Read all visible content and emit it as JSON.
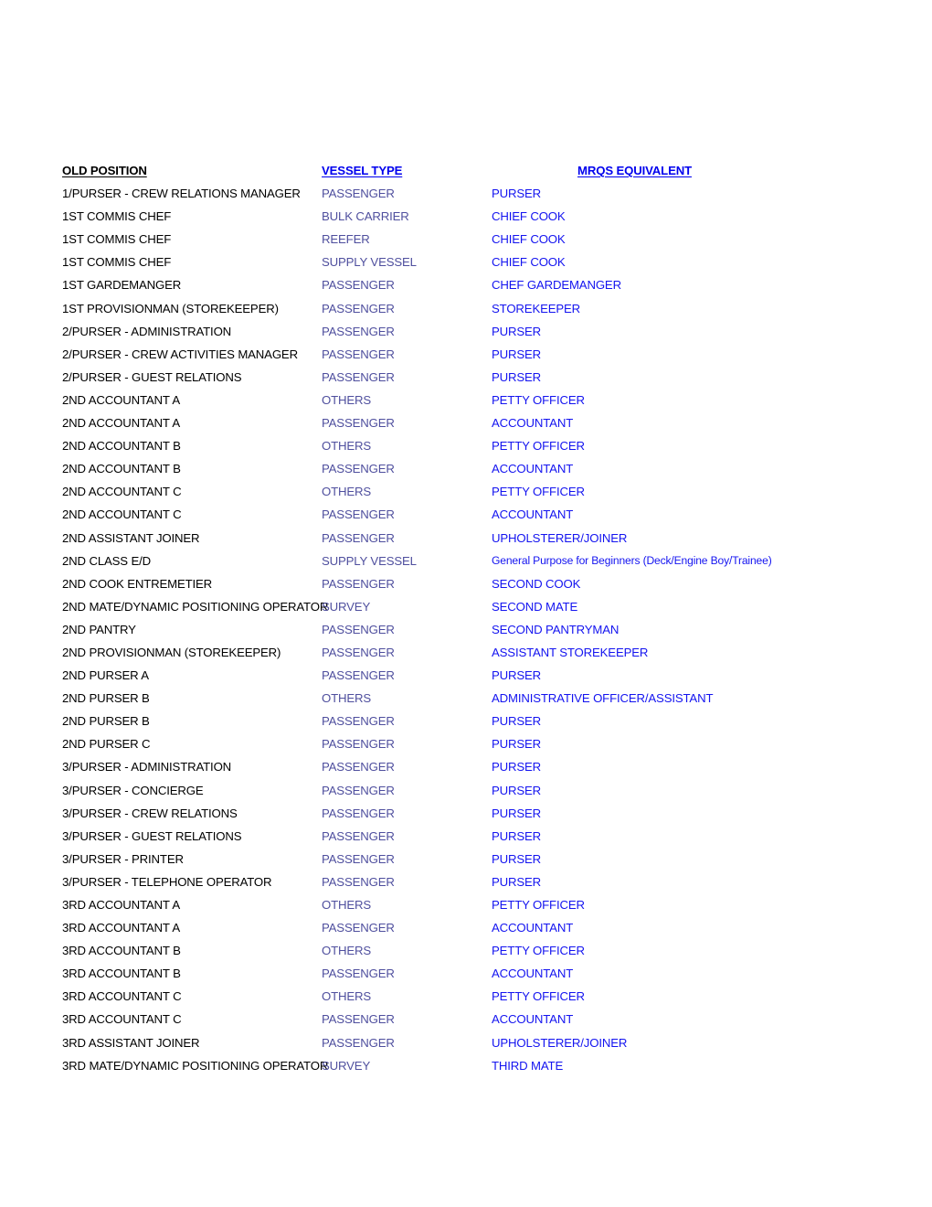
{
  "document": {
    "headers": {
      "col1": "OLD POSITION",
      "col2": "VESSEL TYPE",
      "col3": "MRQS EQUIVALENT"
    },
    "colors": {
      "col1_text": "#000000",
      "col2_text": "#4f4f9e",
      "col3_text": "#1414f0",
      "header_col1": "#000000",
      "header_accent": "#0000ee",
      "background": "#ffffff"
    },
    "rows": [
      {
        "old_position": "1/PURSER - CREW RELATIONS MANAGER",
        "vessel_type": "PASSENGER",
        "mrqs_equivalent": "PURSER"
      },
      {
        "old_position": "1ST COMMIS CHEF",
        "vessel_type": "BULK CARRIER",
        "mrqs_equivalent": "CHIEF COOK"
      },
      {
        "old_position": "1ST COMMIS CHEF",
        "vessel_type": "REEFER",
        "mrqs_equivalent": "CHIEF COOK"
      },
      {
        "old_position": "1ST COMMIS CHEF",
        "vessel_type": "SUPPLY VESSEL",
        "mrqs_equivalent": "CHIEF COOK"
      },
      {
        "old_position": "1ST GARDEMANGER",
        "vessel_type": "PASSENGER",
        "mrqs_equivalent": "CHEF GARDEMANGER"
      },
      {
        "old_position": "1ST PROVISIONMAN (STOREKEEPER)",
        "vessel_type": "PASSENGER",
        "mrqs_equivalent": "STOREKEEPER"
      },
      {
        "old_position": "2/PURSER - ADMINISTRATION",
        "vessel_type": "PASSENGER",
        "mrqs_equivalent": "PURSER"
      },
      {
        "old_position": "2/PURSER - CREW ACTIVITIES MANAGER",
        "vessel_type": "PASSENGER",
        "mrqs_equivalent": "PURSER"
      },
      {
        "old_position": "2/PURSER - GUEST RELATIONS",
        "vessel_type": "PASSENGER",
        "mrqs_equivalent": "PURSER"
      },
      {
        "old_position": "2ND ACCOUNTANT A",
        "vessel_type": "OTHERS",
        "mrqs_equivalent": "PETTY OFFICER"
      },
      {
        "old_position": "2ND ACCOUNTANT A",
        "vessel_type": "PASSENGER",
        "mrqs_equivalent": "ACCOUNTANT"
      },
      {
        "old_position": "2ND ACCOUNTANT B",
        "vessel_type": "OTHERS",
        "mrqs_equivalent": "PETTY OFFICER"
      },
      {
        "old_position": "2ND ACCOUNTANT B",
        "vessel_type": "PASSENGER",
        "mrqs_equivalent": "ACCOUNTANT"
      },
      {
        "old_position": "2ND ACCOUNTANT C",
        "vessel_type": "OTHERS",
        "mrqs_equivalent": "PETTY OFFICER"
      },
      {
        "old_position": "2ND ACCOUNTANT C",
        "vessel_type": "PASSENGER",
        "mrqs_equivalent": "ACCOUNTANT"
      },
      {
        "old_position": "2ND ASSISTANT JOINER",
        "vessel_type": "PASSENGER",
        "mrqs_equivalent": "UPHOLSTERER/JOINER"
      },
      {
        "old_position": "2ND CLASS E/D",
        "vessel_type": "SUPPLY VESSEL",
        "mrqs_equivalent": "General Purpose for Beginners (Deck/Engine Boy/Trainee)",
        "small": true
      },
      {
        "old_position": "2ND COOK ENTREMETIER",
        "vessel_type": "PASSENGER",
        "mrqs_equivalent": "SECOND COOK"
      },
      {
        "old_position": "2ND MATE/DYNAMIC POSITIONING OPERATOR",
        "vessel_type": "SURVEY",
        "mrqs_equivalent": "SECOND MATE"
      },
      {
        "old_position": "2ND PANTRY",
        "vessel_type": "PASSENGER",
        "mrqs_equivalent": "SECOND PANTRYMAN"
      },
      {
        "old_position": "2ND PROVISIONMAN (STOREKEEPER)",
        "vessel_type": "PASSENGER",
        "mrqs_equivalent": "ASSISTANT STOREKEEPER"
      },
      {
        "old_position": "2ND PURSER A",
        "vessel_type": "PASSENGER",
        "mrqs_equivalent": "PURSER"
      },
      {
        "old_position": "2ND PURSER B",
        "vessel_type": "OTHERS",
        "mrqs_equivalent": "ADMINISTRATIVE OFFICER/ASSISTANT"
      },
      {
        "old_position": "2ND PURSER B",
        "vessel_type": "PASSENGER",
        "mrqs_equivalent": "PURSER"
      },
      {
        "old_position": "2ND PURSER C",
        "vessel_type": "PASSENGER",
        "mrqs_equivalent": "PURSER"
      },
      {
        "old_position": "3/PURSER - ADMINISTRATION",
        "vessel_type": "PASSENGER",
        "mrqs_equivalent": "PURSER"
      },
      {
        "old_position": "3/PURSER - CONCIERGE",
        "vessel_type": "PASSENGER",
        "mrqs_equivalent": "PURSER"
      },
      {
        "old_position": "3/PURSER - CREW RELATIONS",
        "vessel_type": "PASSENGER",
        "mrqs_equivalent": "PURSER"
      },
      {
        "old_position": "3/PURSER - GUEST RELATIONS",
        "vessel_type": "PASSENGER",
        "mrqs_equivalent": "PURSER"
      },
      {
        "old_position": "3/PURSER - PRINTER",
        "vessel_type": "PASSENGER",
        "mrqs_equivalent": "PURSER"
      },
      {
        "old_position": "3/PURSER - TELEPHONE OPERATOR",
        "vessel_type": "PASSENGER",
        "mrqs_equivalent": "PURSER"
      },
      {
        "old_position": "3RD ACCOUNTANT A",
        "vessel_type": "OTHERS",
        "mrqs_equivalent": "PETTY OFFICER"
      },
      {
        "old_position": "3RD ACCOUNTANT A",
        "vessel_type": "PASSENGER",
        "mrqs_equivalent": "ACCOUNTANT"
      },
      {
        "old_position": "3RD ACCOUNTANT B",
        "vessel_type": "OTHERS",
        "mrqs_equivalent": "PETTY OFFICER"
      },
      {
        "old_position": "3RD ACCOUNTANT B",
        "vessel_type": "PASSENGER",
        "mrqs_equivalent": "ACCOUNTANT"
      },
      {
        "old_position": "3RD ACCOUNTANT C",
        "vessel_type": "OTHERS",
        "mrqs_equivalent": "PETTY OFFICER"
      },
      {
        "old_position": "3RD ACCOUNTANT C",
        "vessel_type": "PASSENGER",
        "mrqs_equivalent": "ACCOUNTANT"
      },
      {
        "old_position": "3RD ASSISTANT JOINER",
        "vessel_type": "PASSENGER",
        "mrqs_equivalent": "UPHOLSTERER/JOINER"
      },
      {
        "old_position": "3RD MATE/DYNAMIC POSITIONING OPERATOR",
        "vessel_type": "SURVEY",
        "mrqs_equivalent": "THIRD MATE"
      }
    ]
  }
}
